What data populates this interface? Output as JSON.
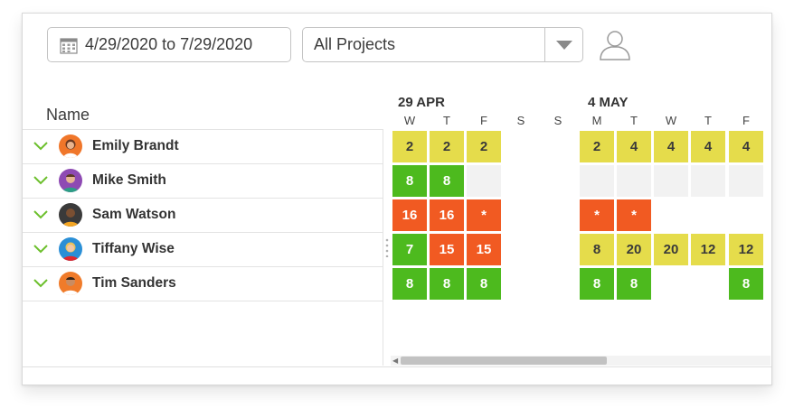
{
  "toolbar": {
    "date_range": "4/29/2020 to 7/29/2020",
    "date_icon": "calendar-icon",
    "project_filter": "All Projects",
    "dropdown_icon": "chevron-down-icon",
    "user_icon": "user-icon"
  },
  "left_header": "Name",
  "weeks": [
    {
      "label": "29 APR"
    },
    {
      "label": "4 MAY"
    }
  ],
  "days": [
    "W",
    "T",
    "F",
    "S",
    "S",
    "M",
    "T",
    "W",
    "T",
    "F"
  ],
  "people": [
    {
      "name": "Emily Brandt",
      "expand_icon": "chevron-down-icon",
      "avatar": "avatar"
    },
    {
      "name": "Mike Smith",
      "expand_icon": "chevron-down-icon",
      "avatar": "avatar"
    },
    {
      "name": "Sam Watson",
      "expand_icon": "chevron-down-icon",
      "avatar": "avatar"
    },
    {
      "name": "Tiffany Wise",
      "expand_icon": "chevron-down-icon",
      "avatar": "avatar"
    },
    {
      "name": "Tim Sanders",
      "expand_icon": "chevron-down-icon",
      "avatar": "avatar"
    }
  ],
  "grid": [
    [
      "2",
      "2",
      "2",
      "",
      "",
      "2",
      "4",
      "4",
      "4",
      "4"
    ],
    [
      "8",
      "8",
      "",
      "",
      "",
      "",
      "",
      "",
      "",
      ""
    ],
    [
      "16",
      "16",
      "*",
      "",
      "",
      "*",
      "*",
      "",
      "",
      ""
    ],
    [
      "7",
      "15",
      "15",
      "",
      "",
      "8",
      "20",
      "20",
      "12",
      "12"
    ],
    [
      "8",
      "8",
      "8",
      "",
      "",
      "8",
      "8",
      "",
      "",
      "8"
    ]
  ],
  "grid_status": [
    [
      "y",
      "y",
      "y",
      "n",
      "n",
      "y",
      "y",
      "y",
      "y",
      "y"
    ],
    [
      "g",
      "g",
      "e",
      "n",
      "n",
      "e",
      "e",
      "e",
      "e",
      "e"
    ],
    [
      "r",
      "r",
      "r",
      "n",
      "n",
      "r",
      "r",
      "n",
      "n",
      "n"
    ],
    [
      "g",
      "r",
      "r",
      "n",
      "n",
      "y",
      "y",
      "y",
      "y",
      "y"
    ],
    [
      "g",
      "g",
      "g",
      "n",
      "n",
      "g",
      "g",
      "n",
      "n",
      "g"
    ]
  ],
  "colors": {
    "yellow": "#e5dc4b",
    "green": "#4dba1e",
    "red": "#f15a22",
    "empty": "#f2f2f2",
    "accent": "#6cbf2c"
  }
}
